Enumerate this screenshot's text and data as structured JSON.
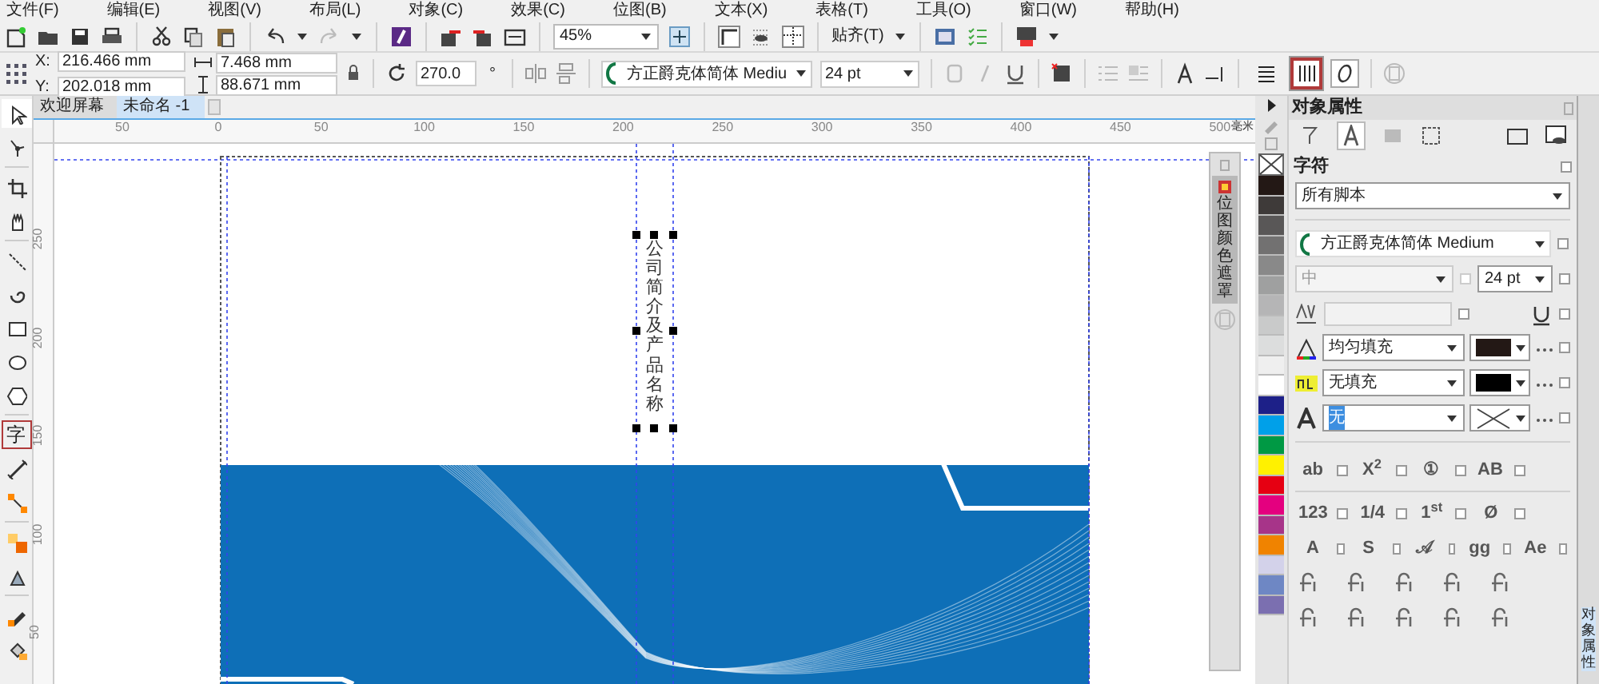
{
  "menu": [
    "文件(F)",
    "编辑(E)",
    "视图(V)",
    "布局(L)",
    "对象(C)",
    "效果(C)",
    "位图(B)",
    "文本(X)",
    "表格(T)",
    "工具(O)",
    "窗口(W)",
    "帮助(H)"
  ],
  "toolbar": {
    "zoom": "45%",
    "snap": "贴齐(T)"
  },
  "property_bar": {
    "x_label": "X:",
    "x": "216.466 mm",
    "y_label": "Y:",
    "y": "202.018 mm",
    "width": "7.468 mm",
    "height": "88.671 mm",
    "angle": "270.0",
    "angle_unit": "°",
    "font": "方正爵克体简体 Mediu",
    "size": "24 pt",
    "text_direction": [
      {
        "kind": "horizontal",
        "selected": false,
        "highlighted": false
      },
      {
        "kind": "vertical",
        "selected": true,
        "highlighted": true
      }
    ]
  },
  "toolbox": [
    {
      "kind": "pick",
      "selected": true,
      "highlighted": false
    },
    {
      "kind": "shape",
      "selected": false,
      "highlighted": false
    },
    {
      "kind": "crop",
      "selected": false,
      "highlighted": false
    },
    {
      "kind": "pan",
      "selected": false,
      "highlighted": false
    },
    {
      "kind": "freehand",
      "selected": false,
      "highlighted": false
    },
    {
      "kind": "spiral",
      "selected": false,
      "highlighted": false
    },
    {
      "kind": "rectangle",
      "selected": false,
      "highlighted": false
    },
    {
      "kind": "ellipse",
      "selected": false,
      "highlighted": false
    },
    {
      "kind": "polygon",
      "selected": false,
      "highlighted": false
    },
    {
      "kind": "text",
      "label": "字",
      "selected": false,
      "highlighted": true
    },
    {
      "kind": "dimension",
      "selected": false,
      "highlighted": false
    },
    {
      "kind": "connector",
      "selected": false,
      "highlighted": false
    },
    {
      "kind": "blend",
      "selected": false,
      "highlighted": false
    },
    {
      "kind": "transparency",
      "selected": false,
      "highlighted": false
    },
    {
      "kind": "eyedropper",
      "selected": false,
      "highlighted": false
    },
    {
      "kind": "fill",
      "selected": false,
      "highlighted": false
    }
  ],
  "document_tabs": [
    {
      "label": "欢迎屏幕",
      "selected": false
    },
    {
      "label": "未命名 -1",
      "selected": true
    }
  ],
  "ruler": {
    "horizontal": [
      "50",
      "0",
      "50",
      "100",
      "150",
      "200",
      "250",
      "300",
      "350",
      "400",
      "450",
      "500"
    ],
    "unit": "毫米",
    "vertical": [
      "250",
      "200",
      "150",
      "100",
      "50"
    ]
  },
  "canvas": {
    "text": "公司简介及产品名称"
  },
  "docker_tab": "位图颜色遮罩",
  "palette": [
    {
      "color": "#231815"
    },
    {
      "color": "#3e3a39"
    },
    {
      "color": "#595757"
    },
    {
      "color": "#727171"
    },
    {
      "color": "#898989"
    },
    {
      "color": "#9fa0a0"
    },
    {
      "color": "#b5b5b6"
    },
    {
      "color": "#c9caca"
    },
    {
      "color": "#dcdddd"
    },
    {
      "color": "#efefef"
    },
    {
      "color": "#ffffff"
    },
    {
      "color": "#1d2088"
    },
    {
      "color": "#00a0e9"
    },
    {
      "color": "#009944"
    },
    {
      "color": "#fff100"
    },
    {
      "color": "#e60012"
    },
    {
      "color": "#e4007f"
    },
    {
      "color": "#a73489"
    },
    {
      "color": "#f08300"
    },
    {
      "color": "#d3d2ea"
    },
    {
      "color": "#6e87c4"
    },
    {
      "color": "#7b6fb0"
    }
  ],
  "panel": {
    "title": "对象属性",
    "section": "字符",
    "section_checked": false,
    "font_checked": false,
    "weight_checked": false,
    "size_checked": false,
    "kerning_checked": false,
    "underline_checked": false,
    "script": "所有脚本",
    "font": "方正爵克体简体 Medium",
    "weight": "中",
    "size": "24 pt",
    "fills": [
      {
        "kind": "fill",
        "label": "均匀填充",
        "color": "#231815",
        "checked": false
      },
      {
        "kind": "background",
        "label": "无填充",
        "color": "#000000",
        "checked": false
      },
      {
        "kind": "outline",
        "label": "无",
        "checked": false
      }
    ],
    "glyph_rows": [
      [
        {
          "label": "ab",
          "checked": false
        },
        {
          "label": "X$^{2}$",
          "checked": false
        },
        {
          "label": "①",
          "checked": false
        },
        {
          "label": "AB",
          "checked": false
        }
      ],
      [
        {
          "label": "123",
          "checked": false
        },
        {
          "label": "1/4",
          "checked": false
        },
        {
          "label": "1$^{st}$",
          "checked": false
        },
        {
          "label": "Ø",
          "checked": false
        }
      ],
      [
        {
          "label": "A",
          "checked": false
        },
        {
          "label": "S",
          "checked": false
        },
        {
          "label": "𝒜",
          "checked": false
        },
        {
          "label": "gg",
          "checked": false
        },
        {
          "label": "Ae",
          "checked": false
        }
      ]
    ]
  },
  "side_tabs": [
    "对象属性"
  ]
}
